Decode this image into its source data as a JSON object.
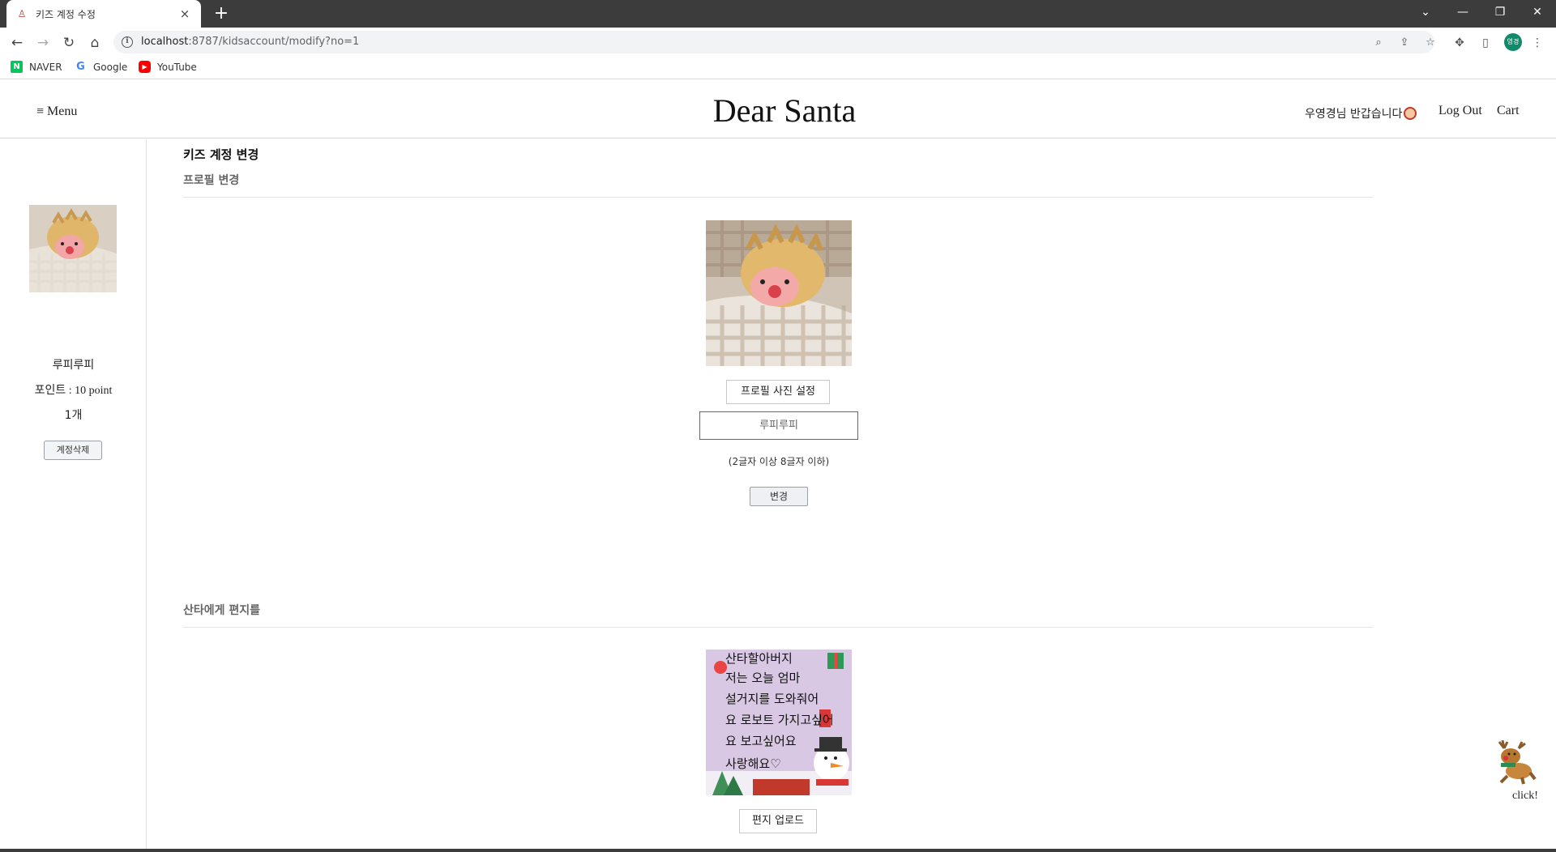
{
  "browser": {
    "tab_title": "키즈 계정 수정",
    "url_host": "localhost",
    "url_rest": ":8787/kidsaccount/modify?no=1",
    "profile_initials": "영경",
    "bookmarks": [
      {
        "label": "NAVER",
        "icon": "naver-icon",
        "color": "#03c75a"
      },
      {
        "label": "Google",
        "icon": "google-icon",
        "color": "#4285f4"
      },
      {
        "label": "YouTube",
        "icon": "youtube-icon",
        "color": "#ff0000"
      }
    ]
  },
  "header": {
    "menu_label": "≡ Menu",
    "brand": "Dear Santa",
    "greeting": "우영경님 반갑습니다",
    "logout_label": "Log Out",
    "cart_label": "Cart"
  },
  "sidebar": {
    "name": "루피루피",
    "points": "포인트 : 10 point",
    "count": "1개",
    "delete_label": "계정삭제"
  },
  "main": {
    "page_title": "키즈 계정 변경",
    "profile_section_title": "프로필 변경",
    "profile_photo_button": "프로필 사진 설정",
    "nickname_value": "루피루피",
    "nickname_hint": "(2글자 이상 8글자 이하)",
    "change_label": "변경",
    "letter_section_title": "산타에게 편지를",
    "letter_lines": [
      "산타할아버지",
      "저는 오늘 엄마",
      "설거지를 도와줘어",
      "요 로보트 가지고싶어",
      "요 보고싶어요",
      "사랑해요♡"
    ],
    "letter_upload_label": "편지 업로드"
  },
  "floating": {
    "click_label": "click!"
  },
  "colors": {
    "accent_dark": "#3c3c3c",
    "button_bg": "#eef0f3"
  }
}
